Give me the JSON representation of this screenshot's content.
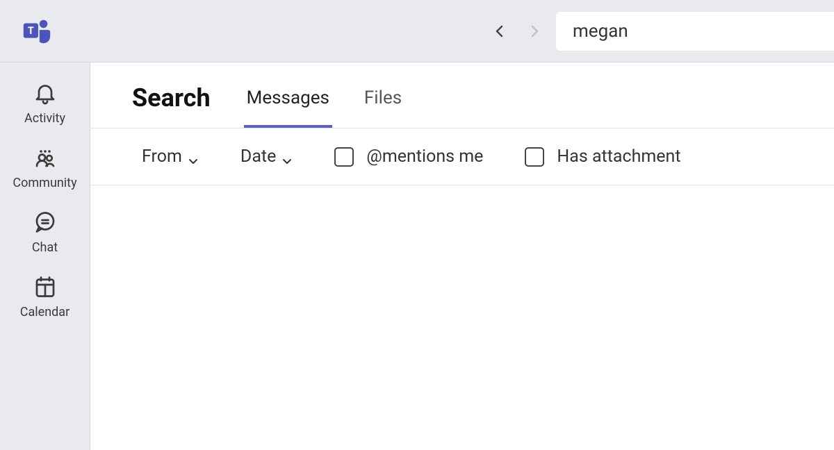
{
  "search": {
    "value": "megan"
  },
  "sidebar": {
    "items": [
      {
        "label": "Activity"
      },
      {
        "label": "Community"
      },
      {
        "label": "Chat"
      },
      {
        "label": "Calendar"
      }
    ]
  },
  "page": {
    "title": "Search"
  },
  "tabs": [
    {
      "label": "Messages",
      "active": true
    },
    {
      "label": "Files",
      "active": false
    }
  ],
  "filters": {
    "from_label": "From",
    "date_label": "Date",
    "mentions_label": "@mentions me",
    "attachment_label": "Has attachment"
  }
}
